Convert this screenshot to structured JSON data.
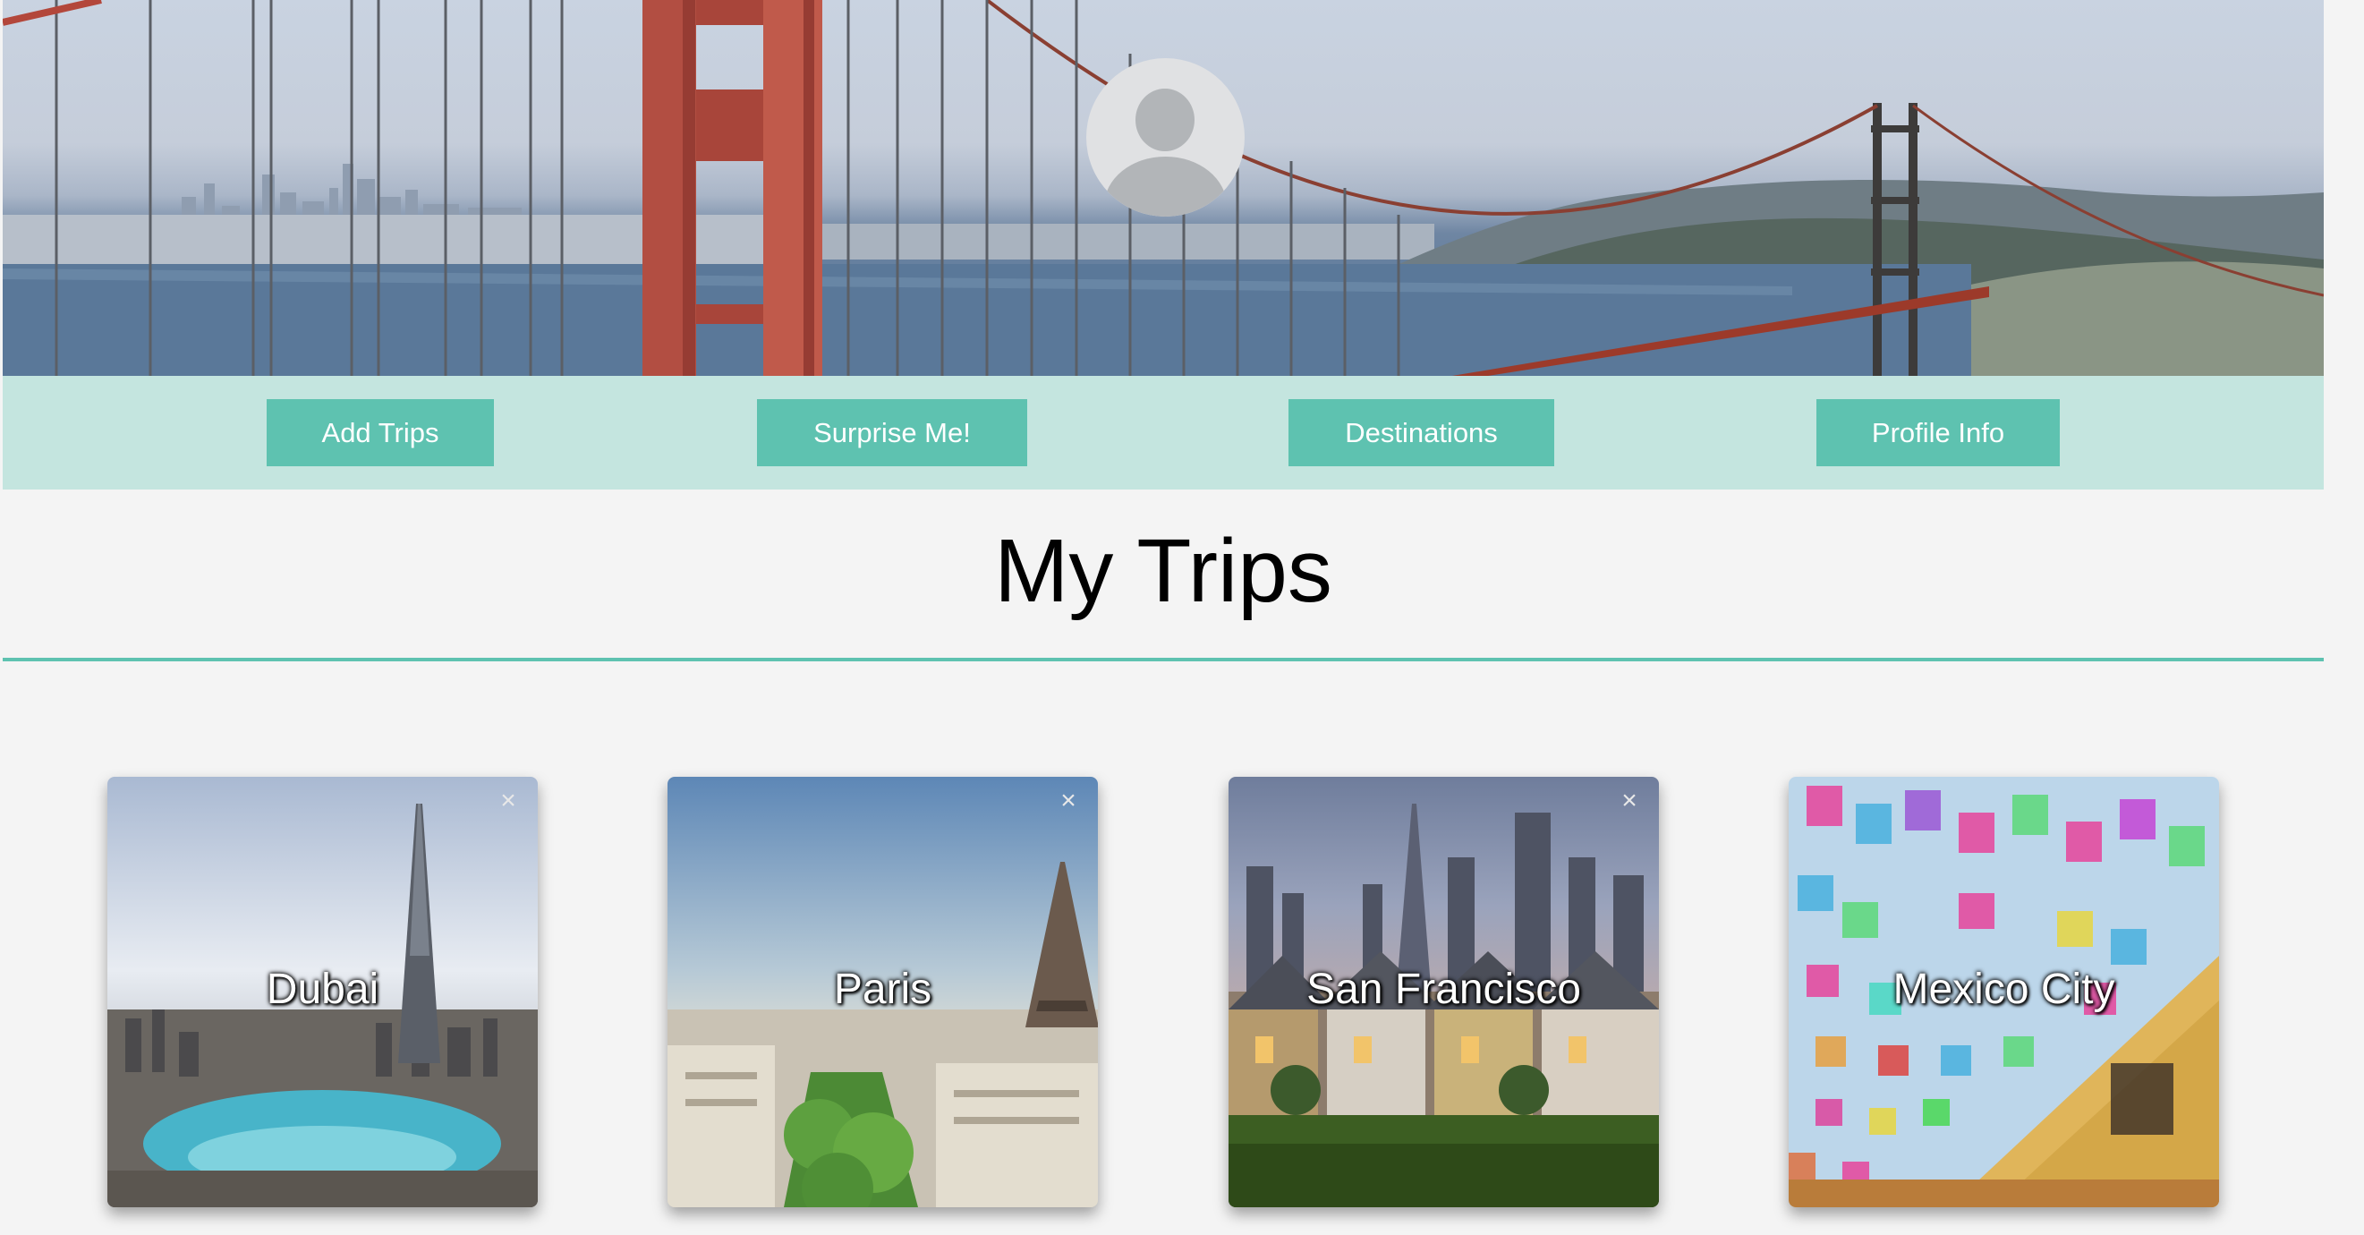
{
  "nav": {
    "add_trips": "Add Trips",
    "surprise_me": "Surprise Me!",
    "destinations": "Destinations",
    "profile_info": "Profile Info"
  },
  "page": {
    "title": "My Trips"
  },
  "trips": [
    {
      "name": "Dubai",
      "close": "×"
    },
    {
      "name": "Paris",
      "close": "×"
    },
    {
      "name": "San Francisco",
      "close": "×"
    },
    {
      "name": "Mexico City"
    }
  ],
  "colors": {
    "accent": "#5ec2b0",
    "nav_background": "#c4e5df",
    "page_background": "#f4f4f4"
  },
  "icons": {
    "avatar": "user-avatar-icon",
    "close": "close-icon"
  }
}
